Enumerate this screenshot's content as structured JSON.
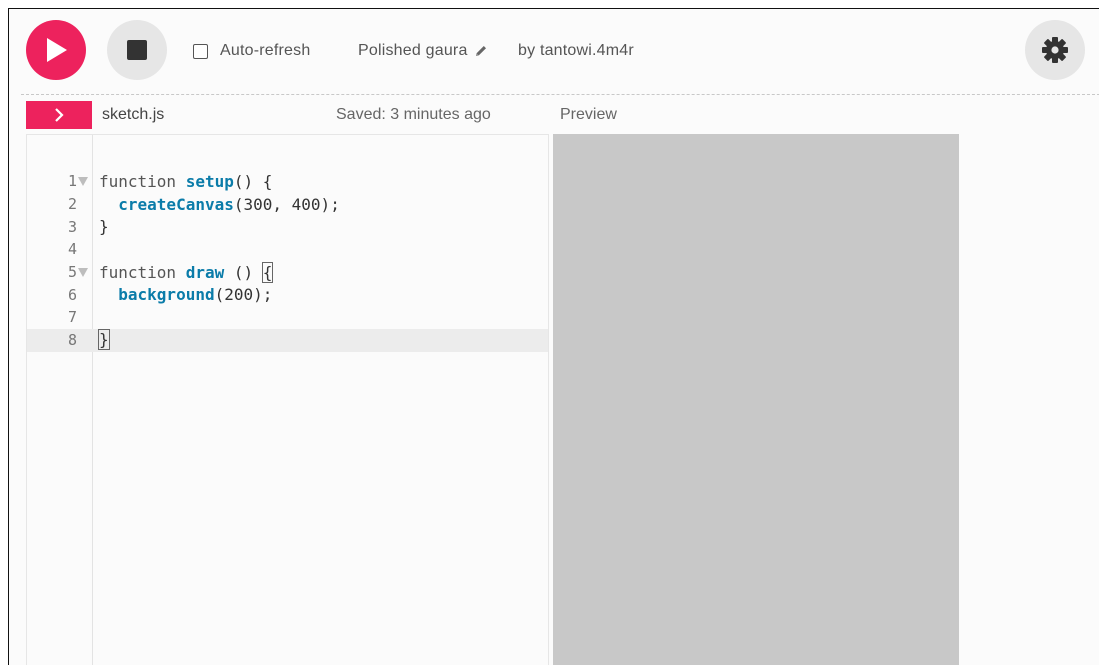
{
  "toolbar": {
    "auto_refresh_label": "Auto-refresh",
    "auto_refresh_checked": false,
    "project_name": "Polished gaura",
    "author": "by tantowi.4m4r"
  },
  "subheader": {
    "file_name": "sketch.js",
    "saved_status": "Saved: 3 minutes ago",
    "preview_label": "Preview"
  },
  "editor": {
    "lines": [
      {
        "number": "1",
        "foldable": true
      },
      {
        "number": "2",
        "foldable": false
      },
      {
        "number": "3",
        "foldable": false
      },
      {
        "number": "4",
        "foldable": false
      },
      {
        "number": "5",
        "foldable": true
      },
      {
        "number": "6",
        "foldable": false
      },
      {
        "number": "7",
        "foldable": false
      },
      {
        "number": "8",
        "foldable": false
      }
    ],
    "tokens": {
      "l1_kw": "function ",
      "l1_fn": "setup",
      "l1_rest": "() {",
      "l2_indent": "  ",
      "l2_fn": "createCanvas",
      "l2_rest": "(300, 400);",
      "l3": "}",
      "l5_kw": "function ",
      "l5_fn": "draw",
      "l5_rest": " () ",
      "l5_brace": "{",
      "l6_indent": "  ",
      "l6_fn": "background",
      "l6_rest": "(200);",
      "l8_brace": "}"
    },
    "active_line": "8"
  },
  "colors": {
    "accent": "#ed225d",
    "button_gray": "#e6e6e6",
    "preview_bg": "#c8c8c8",
    "function_name": "#0b7ca9"
  },
  "icons": {
    "play": "play-icon",
    "stop": "stop-icon",
    "pencil": "pencil-icon",
    "settings": "gear-icon",
    "expand": "chevron-right-icon"
  }
}
